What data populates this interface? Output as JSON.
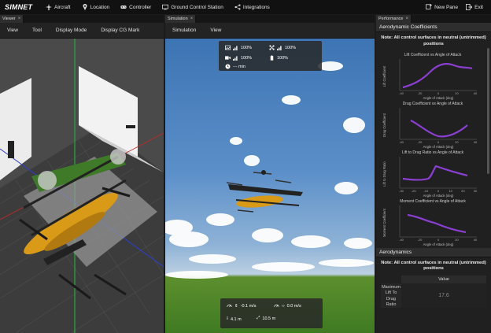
{
  "app": {
    "logo": "SIMNET",
    "nav": [
      "Aircraft",
      "Location",
      "Controller",
      "Ground Control Station",
      "Integrations"
    ],
    "new_pane": "New Pane",
    "exit": "Exit"
  },
  "viewer": {
    "tab": "Viewer",
    "menu": [
      "View",
      "Tool",
      "Display Mode",
      "Display CG Mark"
    ]
  },
  "simulation": {
    "tab": "Simulation",
    "menu": [
      "Simulation",
      "View"
    ],
    "hud_top": {
      "signal1": "100%",
      "signal2": "100%",
      "signal3": "100%",
      "battery": "100%",
      "time": "--- min"
    },
    "hud_bottom": {
      "vertical_speed": "-0.1 m/s",
      "horizontal_speed": "0.0 m/s",
      "altitude": "4.1 m",
      "distance": "10.5 m"
    }
  },
  "performance": {
    "tab": "Performance",
    "section1": "Aerodynamic Coefficients",
    "note": "Note: All control surfaces in neutral (untrimmed) positions",
    "charts": [
      {
        "title": "Lift Coefficient vs Angle of Attack",
        "ylabel": "Lift Coefficient",
        "xlabel": "Angle of Attack (deg)",
        "x_ticks": [
          "-40",
          "-20",
          "0",
          "20",
          "40"
        ]
      },
      {
        "title": "Drag Coefficient vs Angle of Attack",
        "ylabel": "Drag Coefficient",
        "xlabel": "Angle of Attack (deg)",
        "x_ticks": [
          "-40",
          "-20",
          "0",
          "20",
          "40"
        ]
      },
      {
        "title": "Lift to Drag Ratio vs Angle of Attack",
        "ylabel": "Lift to Drag Ratio",
        "xlabel": "Angle of Attack (deg)",
        "x_ticks": [
          "-30",
          "-20",
          "-10",
          "0",
          "10",
          "20",
          "30"
        ]
      },
      {
        "title": "Moment Coefficient vs Angle of Attack",
        "ylabel": "Moment Coefficient",
        "xlabel": "Angle of Attack (deg)",
        "x_ticks": [
          "-40",
          "-20",
          "0",
          "20",
          "40"
        ]
      }
    ],
    "section2": "Aerodynamics",
    "note2": "Note: All control surfaces in neutral (untrimmed) positions",
    "table_header": "Value",
    "table_row_label": "Maximum Lift To Drag Ratio",
    "table_row_value": "17.6"
  },
  "colors": {
    "curve": "#8a3fd1",
    "background": "#202020"
  }
}
